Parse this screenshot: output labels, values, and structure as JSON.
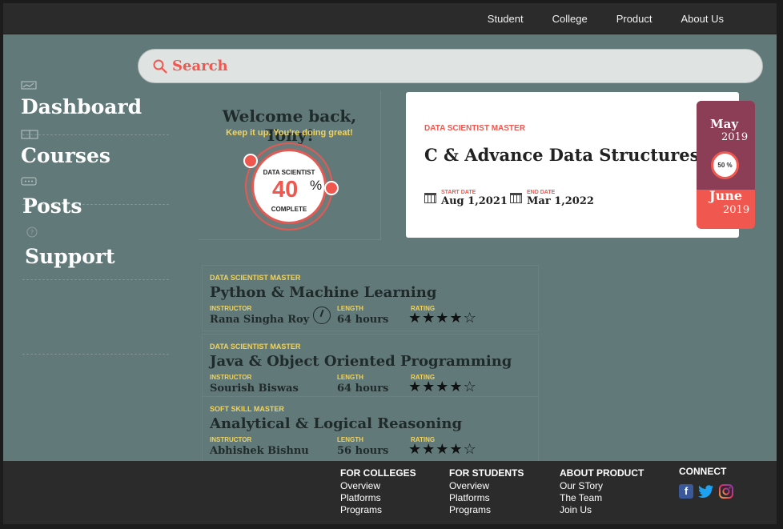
{
  "nav": {
    "items": [
      "Student",
      "College",
      "Product",
      "About Us"
    ]
  },
  "search": {
    "label": "Search"
  },
  "sidebar": {
    "items": [
      {
        "label": "Dashboard",
        "icon": "chart-icon"
      },
      {
        "label": "Courses",
        "icon": "book-icon"
      },
      {
        "label": "Posts",
        "icon": "chat-icon"
      },
      {
        "label": "Support",
        "icon": "help-icon"
      }
    ]
  },
  "welcome": {
    "title": "Welcome back, Tony!",
    "subtitle": "Keep it up. You're doing great!",
    "ring_top": "DATA SCIENTIST",
    "percent": "40",
    "percent_sign": "%",
    "ring_bottom": "COMPLETE",
    "progress": 0.4
  },
  "featured": {
    "tag": "DATA SCIENTIST MASTER",
    "title": "C & Advance Data Structures",
    "start_label": "START DATE",
    "start_value": "Aug 1,2021",
    "end_label": "END DATE",
    "end_value": "Mar 1,2022",
    "month1": "May",
    "year1": "2019",
    "month2": "June",
    "year2": "2019",
    "mini_percent": "50 %"
  },
  "courses": [
    {
      "tag": "DATA SCIENTIST MASTER",
      "title": "Python & Machine Learning",
      "instructor_label": "INSTRUCTOR",
      "instructor": "Rana Singha Roy",
      "length_label": "LENGTH",
      "length": "64 hours",
      "rating_label": "RATING",
      "rating": 4
    },
    {
      "tag": "DATA SCIENTIST MASTER",
      "title": "Java & Object Oriented Programming",
      "instructor_label": "INSTRUCTOR",
      "instructor": "Sourish Biswas",
      "length_label": "LENGTH",
      "length": "64 hours",
      "rating_label": "RATING",
      "rating": 4
    },
    {
      "tag": "SOFT SKILL MASTER",
      "title": "Analytical & Logical Reasoning",
      "instructor_label": "INSTRUCTOR",
      "instructor": "Abhishek Bishnu",
      "length_label": "LENGTH",
      "length": "56 hours",
      "rating_label": "RATING",
      "rating": 4
    }
  ],
  "footer": {
    "colleges": {
      "title": "FOR COLLEGES",
      "items": [
        "Overview",
        "Platforms",
        "Programs"
      ]
    },
    "students": {
      "title": "FOR STUDENTS",
      "items": [
        "Overview",
        "Platforms",
        "Programs"
      ]
    },
    "product": {
      "title": "ABOUT PRODUCT",
      "items": [
        "Our STory",
        "The Team",
        "Join Us"
      ]
    },
    "connect": {
      "title": "CONNECT",
      "icons": [
        "facebook-icon",
        "twitter-icon",
        "instagram-icon"
      ]
    }
  },
  "colors": {
    "accent": "#f0584f",
    "yellow": "#f2d45c",
    "panel": "#627979",
    "plum": "#8b3e55"
  }
}
